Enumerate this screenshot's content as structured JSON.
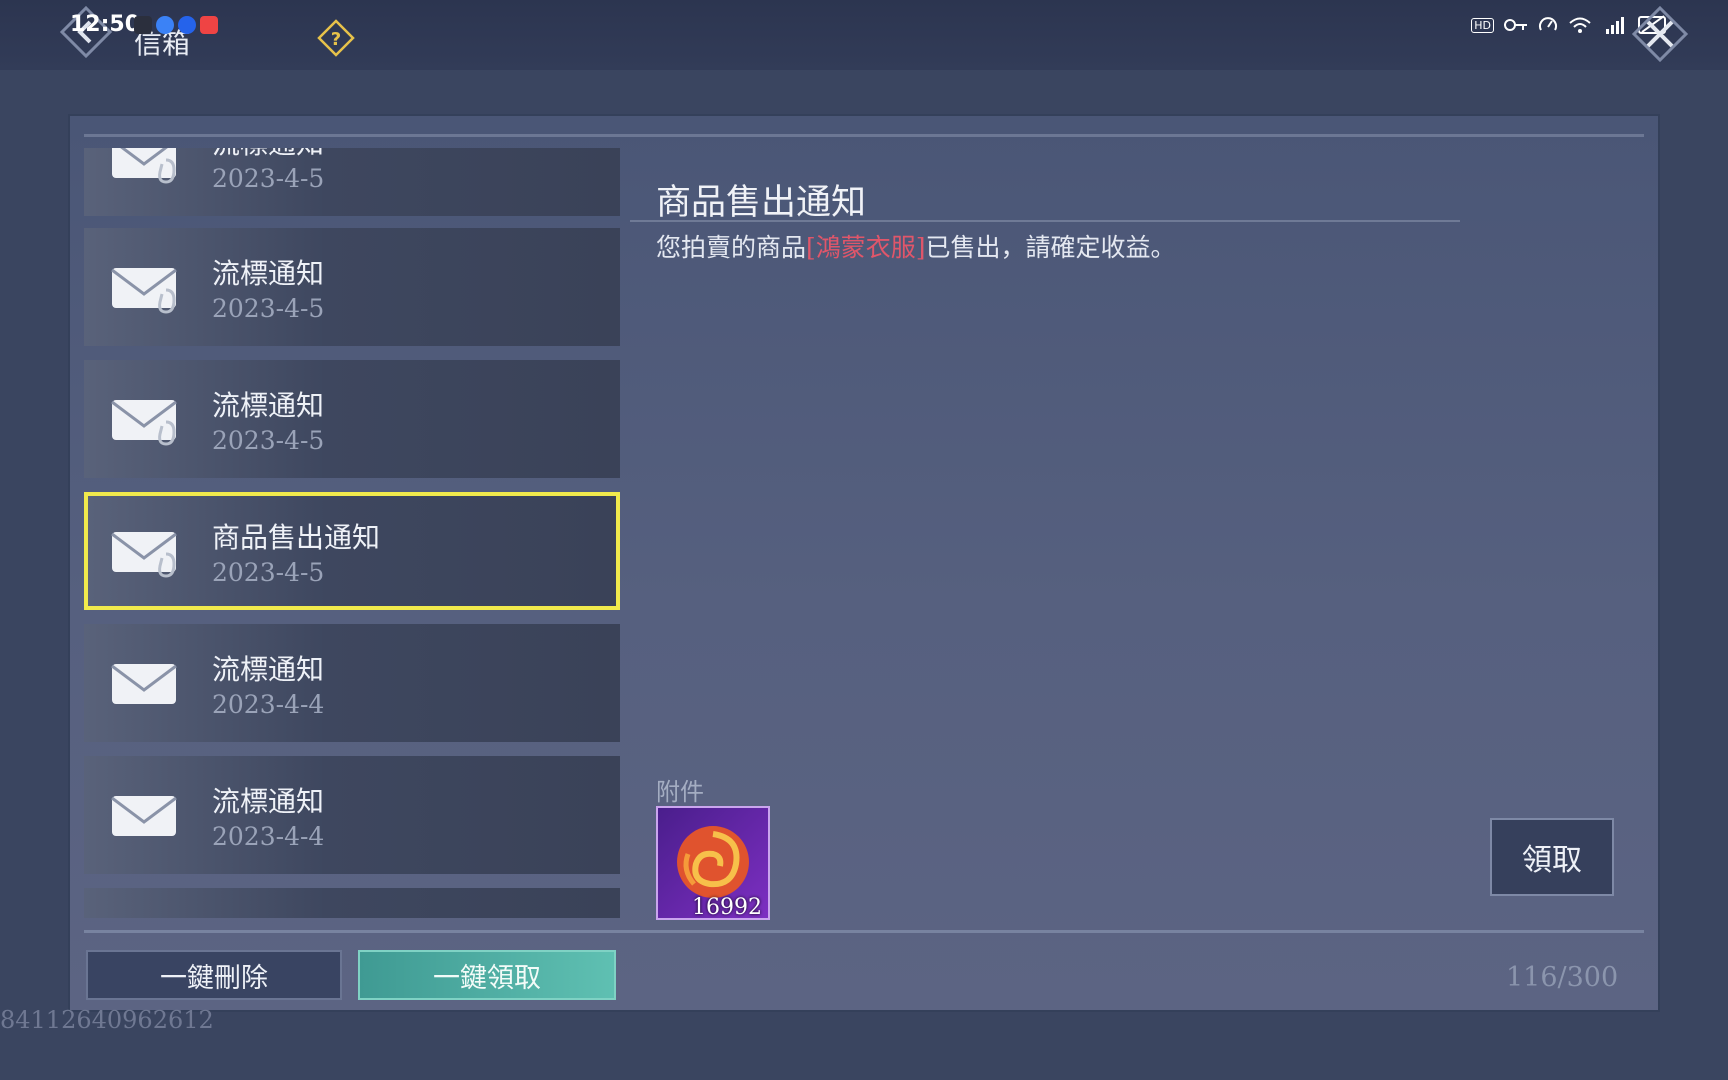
{
  "status_bar": {
    "time": "12:50",
    "right_icons": [
      "hd-icon",
      "key-icon",
      "speedometer-icon",
      "wifi-icon",
      "signal-icon",
      "screen-cast-icon"
    ],
    "network_label": "HD"
  },
  "header": {
    "title": "信箱"
  },
  "mail_list": [
    {
      "title": "流標通知",
      "date": "2023-4-5"
    },
    {
      "title": "流標通知",
      "date": "2023-4-5"
    },
    {
      "title": "流標通知",
      "date": "2023-4-5"
    },
    {
      "title": "商品售出通知",
      "date": "2023-4-5"
    },
    {
      "title": "流標通知",
      "date": "2023-4-4"
    },
    {
      "title": "流標通知",
      "date": "2023-4-4"
    }
  ],
  "selected_index": 3,
  "detail": {
    "title": "商品售出通知",
    "body_prefix": "您拍賣的商品",
    "item_name": "[鴻蒙衣服]",
    "body_suffix": "已售出，請確定收益。",
    "attachment_label": "附件",
    "attachment_quantity": "16992",
    "claim_label": "領取"
  },
  "footer": {
    "delete_all_label": "一鍵刪除",
    "claim_all_label": "一鍵領取",
    "mail_count": "116/300"
  },
  "user_id": "84112640962612",
  "colors": {
    "accent_highlight": "#f1ea4c",
    "item_name": "#e0566a",
    "claim_all": "#4fae9f"
  }
}
